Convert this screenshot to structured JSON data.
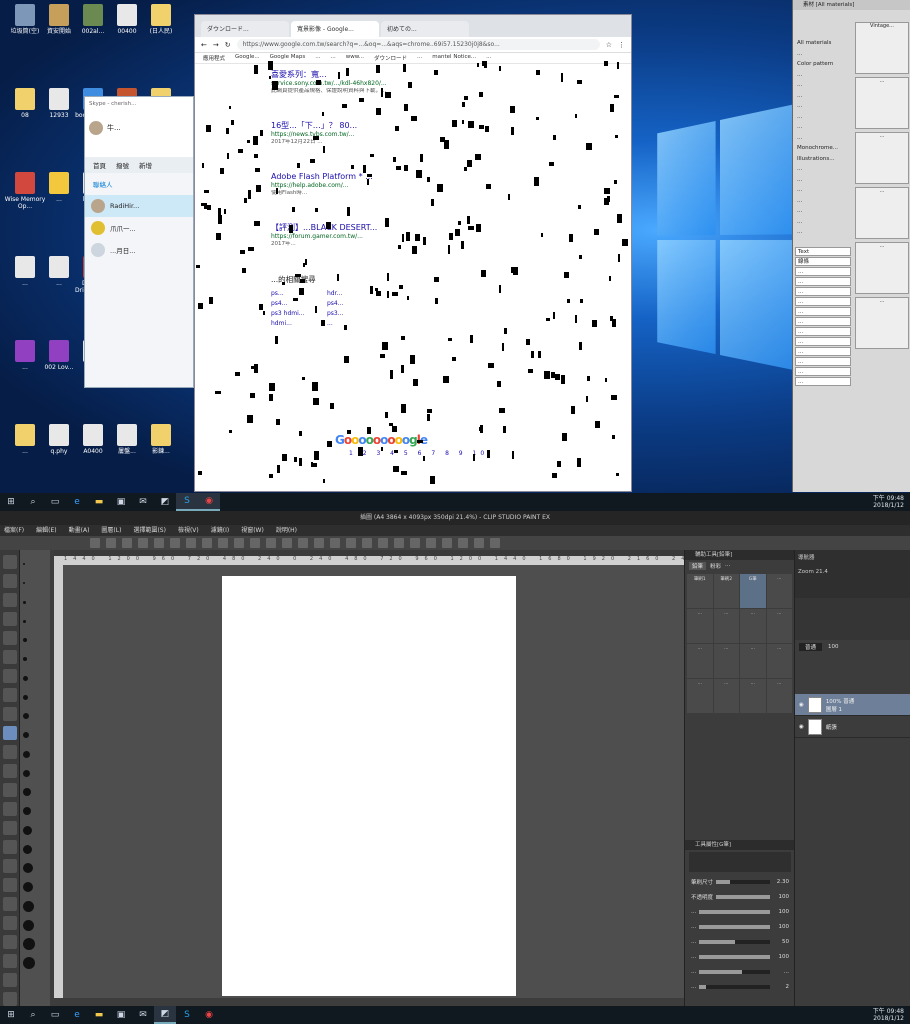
{
  "desktop": {
    "icons": [
      {
        "label": "垃圾筒(空)",
        "color": "#7d97b8"
      },
      {
        "label": "資安開始",
        "color": "#c6a05a"
      },
      {
        "label": "002al...",
        "color": "#6a8a52"
      },
      {
        "label": "00400",
        "color": "#e8e8e8"
      },
      {
        "label": "(日人民)",
        "color": "#f1d16b"
      },
      {
        "label": "08",
        "color": "#f1d16b"
      },
      {
        "label": "12933",
        "color": "#e8e8e8"
      },
      {
        "label": "bookmark...",
        "color": "#3f8de0"
      },
      {
        "label": "13kVPI5...",
        "color": "#c5552e"
      },
      {
        "label": "Archive...",
        "color": "#f1d16b"
      },
      {
        "label": "Wise Memory Op...",
        "color": "#d2473e"
      },
      {
        "label": "...",
        "color": "#f3c83d"
      },
      {
        "label": "book...",
        "color": "#e8e8e8"
      },
      {
        "label": "The Mist (2007)...",
        "color": "#e8e8e8"
      },
      {
        "label": "4A...",
        "color": "#e8e8e8"
      },
      {
        "label": "...",
        "color": "#e8e8e8"
      },
      {
        "label": "...",
        "color": "#e8e8e8"
      },
      {
        "label": "Display Driver Uni...",
        "color": "#c04040"
      },
      {
        "label": "...",
        "color": "#9040c0"
      },
      {
        "label": "002 Lov...",
        "color": "#9040c0"
      },
      {
        "label": "...",
        "color": "#9040c0"
      },
      {
        "label": "002 Lov...",
        "color": "#9040c0"
      },
      {
        "label": "...",
        "color": "#e8e8e8"
      },
      {
        "label": "2515...",
        "color": "#e8e8e8"
      },
      {
        "label": "可證紙有...",
        "color": "#e8e8e8"
      },
      {
        "label": "...",
        "color": "#f1d16b"
      },
      {
        "label": "q.phy",
        "color": "#e8e8e8"
      },
      {
        "label": "A0400",
        "color": "#e8e8e8"
      },
      {
        "label": "屢盤...",
        "color": "#e8e8e8"
      },
      {
        "label": "影鍊...",
        "color": "#f1d16b"
      }
    ]
  },
  "chrome": {
    "tabs": [
      "ダウンロード...",
      "寬景影像 - Google...",
      "初めての..."
    ],
    "url": "https://www.google.com.tw/search?q=...&oq=...&aqs=chrome..69i57.15230j0j8&so...",
    "bookmarks": [
      "應用程式",
      "Google...",
      "Google Maps",
      "...",
      "...",
      "www...",
      "ダウンロード",
      "...",
      "mantel Notice...",
      "..."
    ],
    "results": [
      {
        "title": "喜愛系列：寬...",
        "url": "service.sony.com.tw/.../kdl-46hx820/...",
        "desc": "此網頁提供產品規格、保證說明資料與下載，..."
      },
      {
        "title": "16型...「下…」？ 80...",
        "url": "https://news.tvbs.com.tw/...",
        "desc": "2017年12月22日 ..."
      },
      {
        "title": "Adobe Flash Platform * ...",
        "url": "https://help.adobe.com/...",
        "desc": "使用Flash時..."
      },
      {
        "title": "【評測】...BLACK DESERT...",
        "url": "https://forum.gamer.com.tw/...",
        "desc": "2017年..."
      }
    ],
    "related_heading": "...的相關搜尋",
    "related": [
      "ps...",
      "hdr...",
      "ps4...",
      "ps4...",
      "ps3 hdmi...",
      "ps3...",
      "hdmi...",
      "..."
    ],
    "pager_word": "Gooooooooogle",
    "pager_numbers": "1 2 3 4 5 6 7 8 9 10"
  },
  "skype": {
    "title": "Skype - cherish...",
    "user": "牛...",
    "nav": [
      "首頁",
      "撥號",
      "新增"
    ],
    "section": "聯絡人",
    "contacts": [
      "RadiHir...",
      "爪爪一...",
      "...月日..."
    ]
  },
  "clip_material": {
    "title": "素材 [All materials]",
    "tree": [
      "All materials",
      "...",
      "Color pattern",
      "...",
      "...",
      "...",
      "...",
      "...",
      "...",
      "...",
      "Monochrome...",
      "Illustrations...",
      "...",
      "...",
      "...",
      "...",
      "...",
      "...",
      "..."
    ],
    "thumbs": [
      "Vintage...",
      "...",
      "...",
      "...",
      "...",
      "...",
      "...",
      "...",
      "...",
      "..."
    ],
    "tags": [
      "Text",
      "線條",
      "...",
      "...",
      "...",
      "...",
      "...",
      "...",
      "...",
      "...",
      "...",
      "...",
      "...",
      "..."
    ]
  },
  "taskbar_top": {
    "time": "下午 09:48",
    "date": "2018/1/12"
  },
  "taskbar_bottom": {
    "time": "下午 09:48",
    "date": "2018/1/12"
  },
  "csp": {
    "title": "插圖 (A4 3864 x 4093px 350dpi 21.4%) - CLIP STUDIO PAINT EX",
    "menu": [
      "檔案(F)",
      "編輯(E)",
      "動畫(A)",
      "圖層(L)",
      "選擇範圍(S)",
      "檢視(V)",
      "濾鏡(I)",
      "視窗(W)",
      "說明(H)"
    ],
    "ruler": "1440  1200  960  720  480  240  0  240  480  720  960  1200  1440  1680  1920  2160  2400  2640  2880  3120",
    "brush_panel_title": "輔助工具[鉛筆]",
    "brush_tabs": [
      "鉛筆",
      "粉彩",
      "..."
    ],
    "brushes": [
      "筆刷1",
      "筆刷2",
      "G筆",
      "...",
      "...",
      "...",
      "...",
      "...",
      "...",
      "...",
      "...",
      "...",
      "...",
      "...",
      "...",
      "..."
    ],
    "props_title": "工具屬性[G筆]",
    "props": [
      {
        "label": "筆刷尺寸",
        "value": "2.30",
        "fill": 0.25
      },
      {
        "label": "不透明度",
        "value": "100",
        "fill": 1
      },
      {
        "label": "...",
        "value": "100",
        "fill": 1
      },
      {
        "label": "...",
        "value": "100",
        "fill": 1
      },
      {
        "label": "...",
        "value": "50",
        "fill": 0.5
      },
      {
        "label": "...",
        "value": "100",
        "fill": 1
      },
      {
        "label": "...",
        "value": "...",
        "fill": 0.6
      },
      {
        "label": "...",
        "value": "2",
        "fill": 0.1
      }
    ],
    "nav_title": "導航器",
    "zoom": "21.4",
    "blend": "普通",
    "opacity": "100",
    "layers": [
      {
        "name": "100% 普通",
        "sub": "圖層 1"
      },
      {
        "name": "紙張",
        "sub": ""
      }
    ]
  }
}
